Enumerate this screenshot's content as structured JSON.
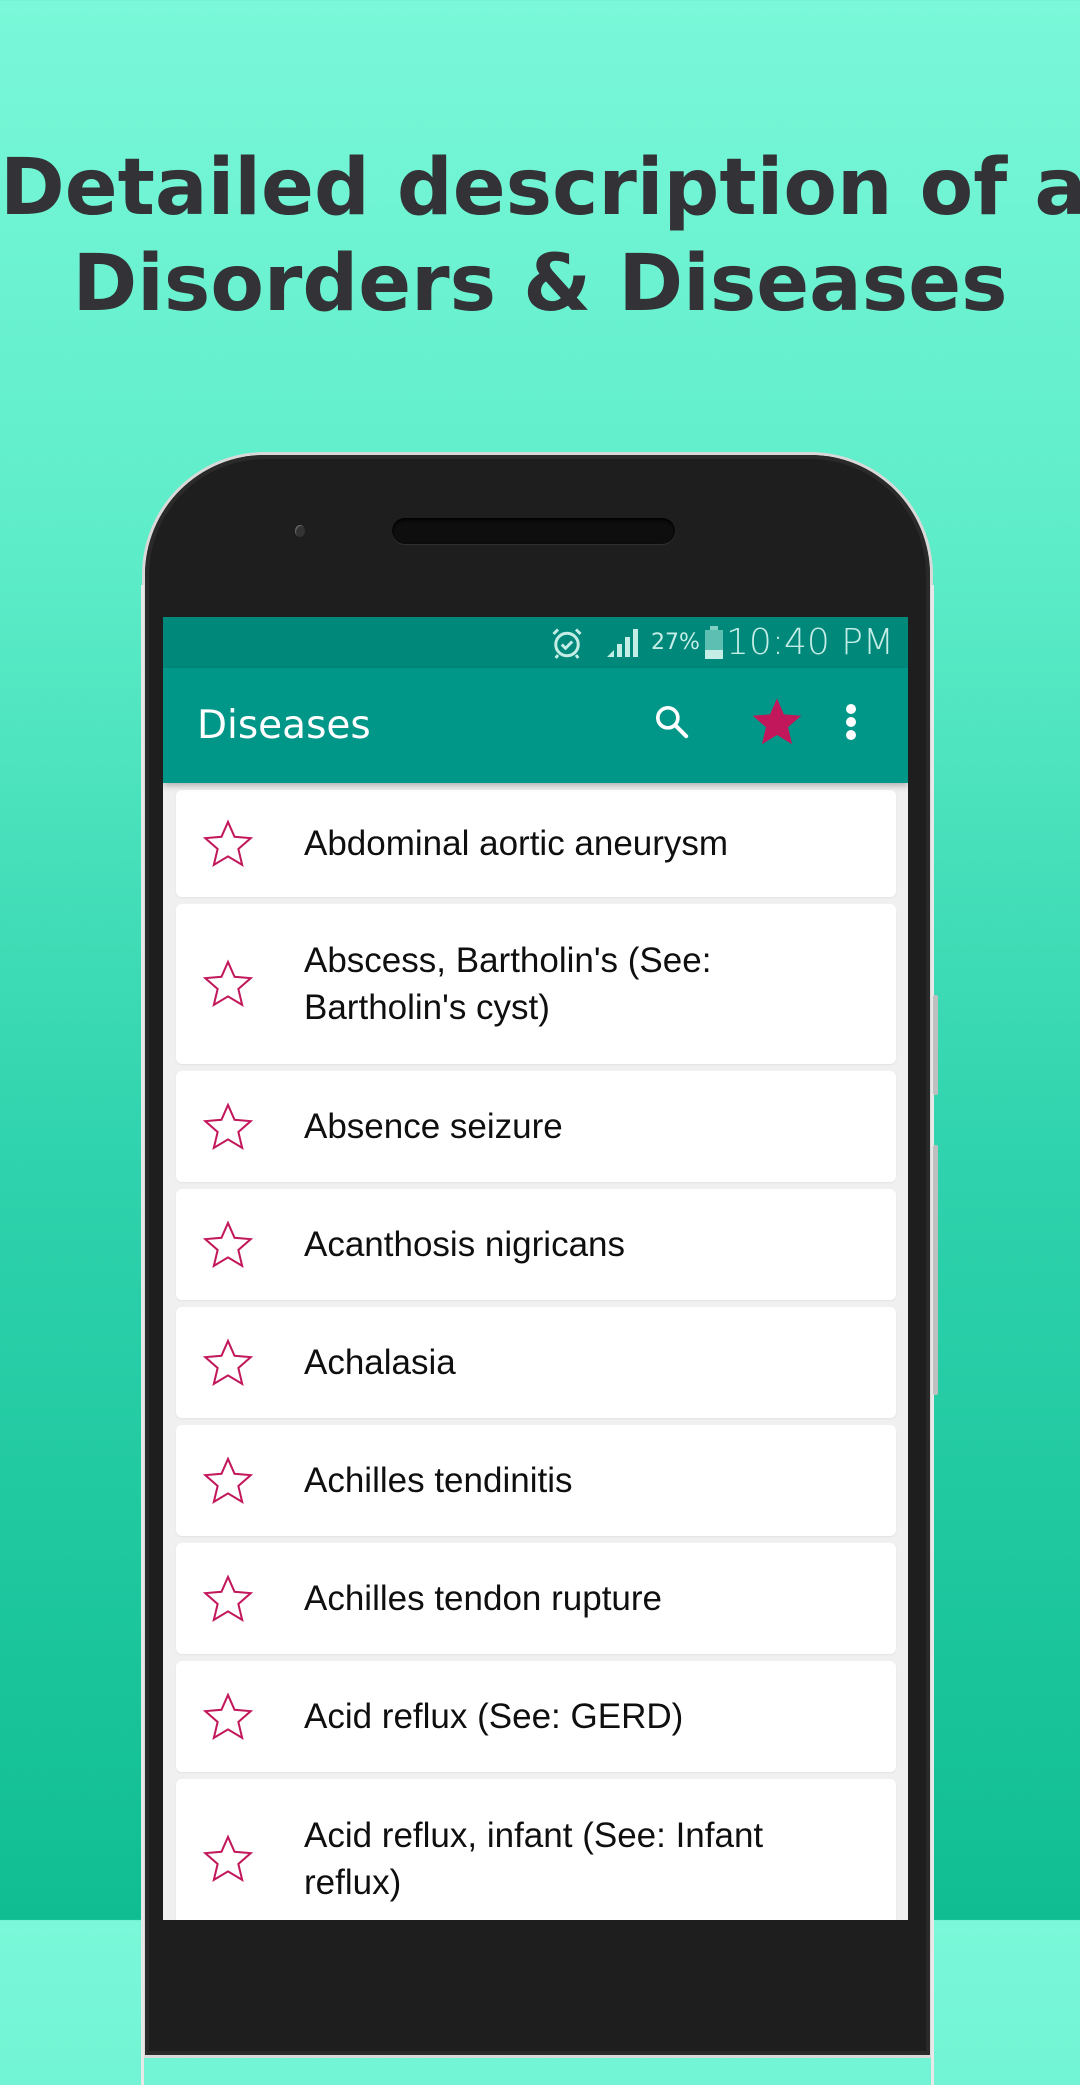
{
  "promo": {
    "headline_line1": "Detailed description of all",
    "headline_line2": "Disorders & Diseases"
  },
  "status_bar": {
    "icons": [
      "alarm-icon",
      "signal-icon",
      "battery-icon"
    ],
    "battery_percent": "27%",
    "time": "10:40 PM"
  },
  "app_bar": {
    "title": "Diseases",
    "actions": [
      {
        "name": "search",
        "icon": "search-icon"
      },
      {
        "name": "favorites",
        "icon": "star-filled-icon"
      },
      {
        "name": "more",
        "icon": "more-vert-icon"
      }
    ]
  },
  "colors": {
    "status_bar": "#00897b",
    "app_bar": "#009688",
    "accent_star": "#c2185b",
    "headline_text": "#333337",
    "background_top": "#7af8d9",
    "background_bottom": "#10bd92"
  },
  "diseases": [
    {
      "label": "Abdominal aortic aneurysm",
      "favorite": false
    },
    {
      "label": "Abscess, Bartholin's (See: Bartholin's cyst)",
      "favorite": false
    },
    {
      "label": "Absence seizure",
      "favorite": false
    },
    {
      "label": "Acanthosis nigricans",
      "favorite": false
    },
    {
      "label": "Achalasia",
      "favorite": false
    },
    {
      "label": "Achilles tendinitis",
      "favorite": false
    },
    {
      "label": "Achilles tendon rupture",
      "favorite": false
    },
    {
      "label": "Acid reflux (See: GERD)",
      "favorite": false
    },
    {
      "label": "Acid reflux, infant (See: Infant reflux)",
      "favorite": false
    }
  ]
}
